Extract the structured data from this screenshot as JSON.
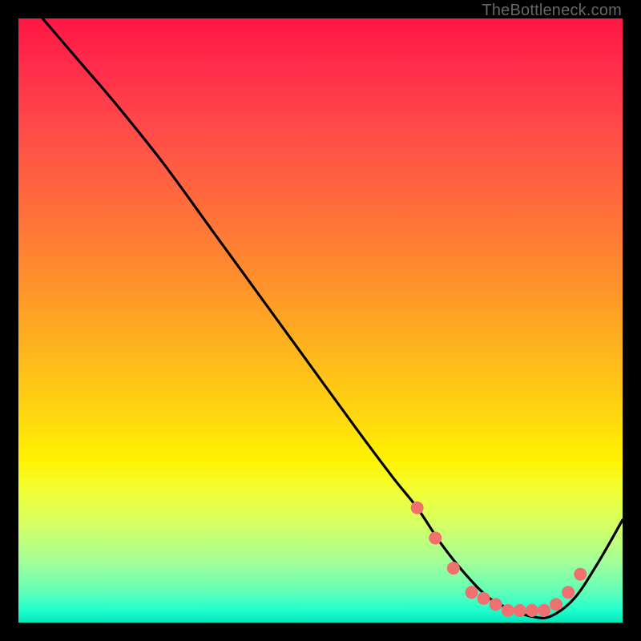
{
  "attribution": "TheBottleneck.com",
  "chart_data": {
    "type": "line",
    "title": "",
    "xlabel": "",
    "ylabel": "",
    "xlim": [
      0,
      100
    ],
    "ylim": [
      0,
      100
    ],
    "series": [
      {
        "name": "curve",
        "color": "#000000",
        "x": [
          4,
          10,
          16,
          24,
          32,
          40,
          48,
          56,
          62,
          66,
          70,
          74,
          78,
          82,
          85,
          88,
          92,
          96,
          100
        ],
        "y": [
          100,
          93,
          86,
          76,
          65,
          54,
          43,
          32,
          24,
          19,
          13,
          8,
          4,
          2,
          1,
          1,
          4,
          10,
          17
        ]
      }
    ],
    "markers": {
      "name": "scatter-dots",
      "color": "#f07070",
      "radius": 8,
      "points": [
        {
          "x": 66,
          "y": 19
        },
        {
          "x": 69,
          "y": 14
        },
        {
          "x": 72,
          "y": 9
        },
        {
          "x": 75,
          "y": 5
        },
        {
          "x": 77,
          "y": 4
        },
        {
          "x": 79,
          "y": 3
        },
        {
          "x": 81,
          "y": 2
        },
        {
          "x": 83,
          "y": 2
        },
        {
          "x": 85,
          "y": 2
        },
        {
          "x": 87,
          "y": 2
        },
        {
          "x": 89,
          "y": 3
        },
        {
          "x": 91,
          "y": 5
        },
        {
          "x": 93,
          "y": 8
        }
      ]
    },
    "background": {
      "type": "vertical-gradient",
      "stops": [
        {
          "pos": 0,
          "color": "#ff1744"
        },
        {
          "pos": 50,
          "color": "#ffb21f"
        },
        {
          "pos": 75,
          "color": "#fff200"
        },
        {
          "pos": 100,
          "color": "#00e6b8"
        }
      ]
    }
  }
}
